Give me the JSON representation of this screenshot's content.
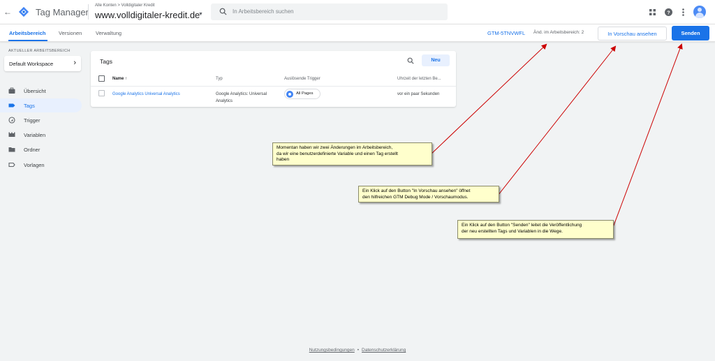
{
  "header": {
    "back_glyph": "←",
    "app_title": "Tag Manager",
    "breadcrumb": "Alle Konten > Volldigitaler Kredit",
    "container_name": "www.volldigitaler-kredit.de",
    "search_placeholder": "In Arbeitsbereich suchen",
    "icons": [
      "back-arrow-icon",
      "tag-manager-logo-icon",
      "search-icon",
      "apps-grid-icon",
      "help-icon",
      "more-vert-icon",
      "account-avatar-icon"
    ]
  },
  "subnav": {
    "tabs": [
      {
        "label": "Arbeitsbereich",
        "active": true
      },
      {
        "label": "Versionen",
        "active": false
      },
      {
        "label": "Verwaltung",
        "active": false
      }
    ],
    "container_id": "GTM-5TNVWFL",
    "changes": "Änd. im Arbeitsbereich: 2",
    "preview_label": "In Vorschau ansehen",
    "submit_label": "Senden"
  },
  "sidebar": {
    "workspace_label": "AKTUELLER ARBEITSBEREICH",
    "workspace_name": "Default Workspace",
    "items": [
      {
        "label": "Übersicht",
        "icon": "briefcase-icon",
        "active": false
      },
      {
        "label": "Tags",
        "icon": "tag-icon",
        "active": true
      },
      {
        "label": "Trigger",
        "icon": "trigger-icon",
        "active": false
      },
      {
        "label": "Variablen",
        "icon": "variables-icon",
        "active": false
      },
      {
        "label": "Ordner",
        "icon": "folder-icon",
        "active": false
      },
      {
        "label": "Vorlagen",
        "icon": "template-icon",
        "active": false
      }
    ]
  },
  "tags_card": {
    "title": "Tags",
    "new_label": "Neu",
    "columns": {
      "name": "Name ↑",
      "type": "Typ",
      "trigger": "Auslösende Trigger",
      "edited": "Uhrzeit der letzten Be..."
    },
    "rows": [
      {
        "name": "Google Analytics Universal Analytics",
        "type_line1": "Google Analytics: Universal",
        "type_line2": "Analytics",
        "trigger": "All Pages",
        "edited": "vor ein paar Sekunden"
      }
    ]
  },
  "annotations": [
    {
      "line1": "Momentan haben wir zwei Änderungen im Arbeitsbereich,",
      "line2": "da wir eine benutzerdefinierte Variable und einen Tag erstellt",
      "line3": "haben"
    },
    {
      "line1": "Ein Klick auf den Button \"In Vorschau ansehen\" öffnet",
      "line2": "den hilfreichen GTM Debug Mode / Vorschaumodus."
    },
    {
      "line1": "Ein Klick auf den Button \"Senden\" leitet die Veröffentlichung",
      "line2": "der neu erstellten Tags und Variablen in die Wege."
    }
  ],
  "footer": {
    "terms": "Nutzungsbedingungen",
    "separator": "•",
    "privacy": "Datenschutzerklärung"
  },
  "colors": {
    "accent": "#1a73e8",
    "note_bg": "#ffffcc",
    "arrow": "#cc0000"
  }
}
